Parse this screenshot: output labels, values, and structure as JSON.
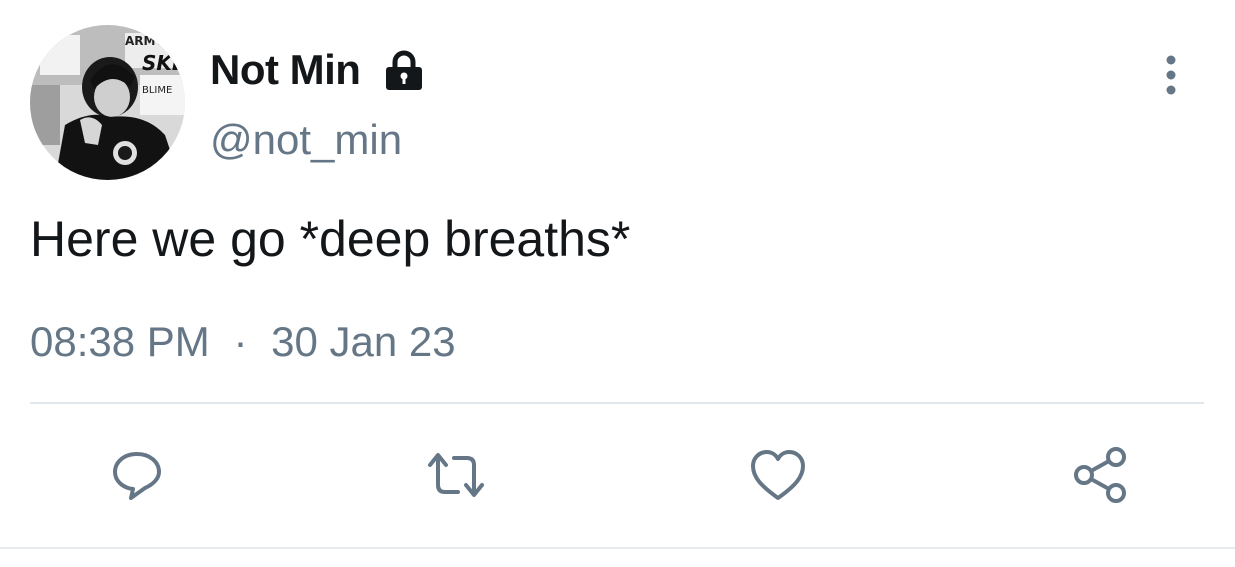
{
  "tweet": {
    "display_name": "Not Min",
    "handle": "@not_min",
    "text": "Here we go *deep breaths*",
    "time": "08:38 PM",
    "separator": "·",
    "date": "30 Jan 23",
    "avatar_caption_words": [
      "ARMY",
      "SKE",
      "BLIME"
    ]
  },
  "icons": {
    "lock": "lock-icon",
    "more": "more-vertical-icon",
    "reply": "reply-icon",
    "retweet": "retweet-icon",
    "like": "heart-icon",
    "share": "share-icon"
  },
  "colors": {
    "text": "#14171a",
    "secondary": "#657786",
    "divider": "#e1e8ed"
  }
}
